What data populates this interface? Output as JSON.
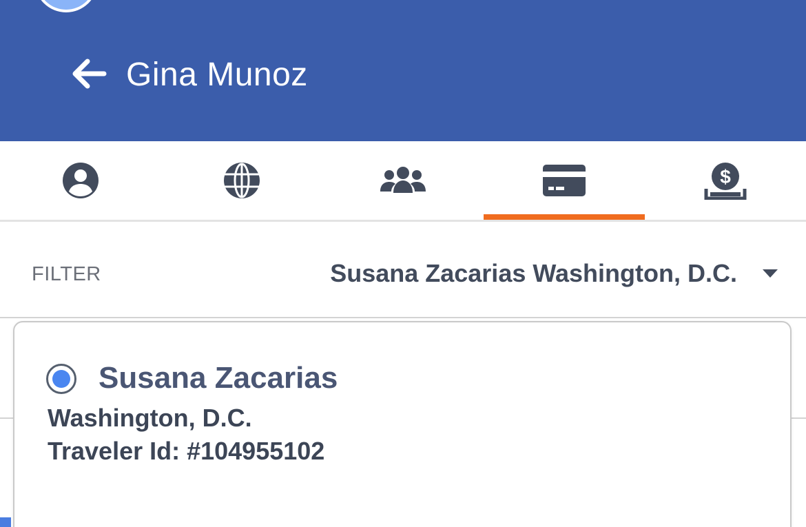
{
  "header": {
    "title": "Gina Munoz",
    "background_color": "#3b5dab",
    "back_icon": "arrow-left-icon"
  },
  "tabs": [
    {
      "icon": "user-circle-icon",
      "active": false
    },
    {
      "icon": "globe-icon",
      "active": false
    },
    {
      "icon": "users-icon",
      "active": false
    },
    {
      "icon": "credit-card-icon",
      "active": true
    },
    {
      "icon": "money-deposit-icon",
      "active": false
    }
  ],
  "tab_active_color": "#f06c1f",
  "filter": {
    "label": "FILTER",
    "selected_value": "Susana Zacarias Washington, D.C.",
    "caret_icon": "caret-down-icon"
  },
  "dropdown": {
    "options": [
      {
        "name": "Susana Zacarias",
        "location": "Washington, D.C.",
        "traveler_id": "Traveler Id: #104955102",
        "selected": true
      }
    ],
    "radio_color": "#4a86f0"
  }
}
